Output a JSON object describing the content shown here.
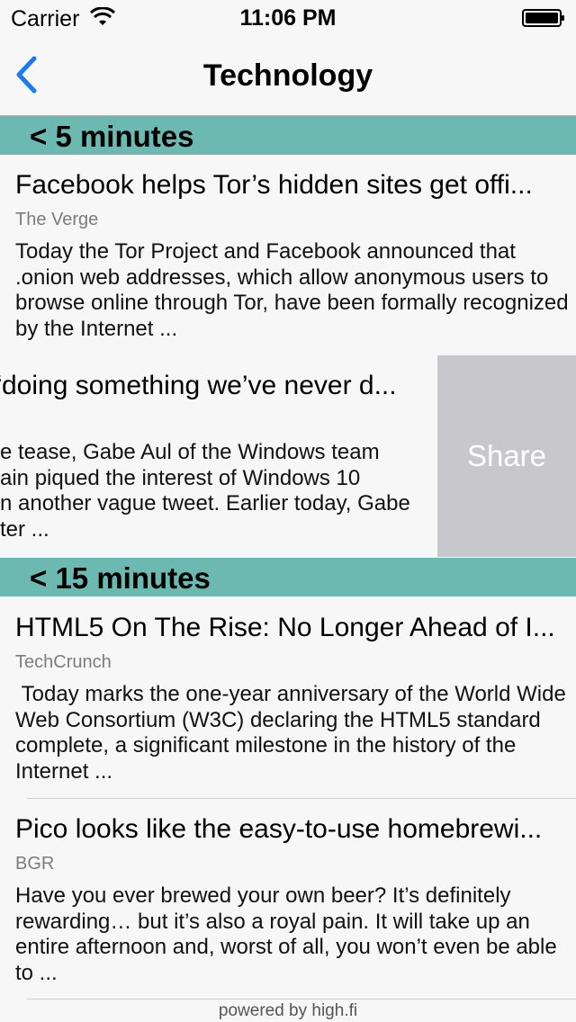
{
  "status_bar": {
    "carrier": "Carrier",
    "time": "11:06 PM"
  },
  "nav": {
    "title": "Technology"
  },
  "sections": [
    {
      "header": "< 5 minutes",
      "articles": [
        {
          "title": "Facebook helps Tor’s hidden sites get offi...",
          "source": "The Verge",
          "excerpt": "Today the Tor Project and Facebook announced that .onion web addresses, which allow anonymous users to browse online through Tor, have been formally recognized by the Internet ..."
        },
        {
          "title": "“doing something we’ve never d...",
          "excerpt_lines": [
            "e tease, Gabe Aul of the Windows team",
            "ain piqued the interest of Windows 10",
            "n another vague tweet. Earlier today, Gabe",
            "ter ..."
          ],
          "share_label": "Share"
        }
      ]
    },
    {
      "header": "< 15 minutes",
      "articles": [
        {
          "title": "HTML5 On The Rise: No Longer Ahead of I...",
          "source": "TechCrunch",
          "excerpt": " Today marks the one-year anniversary of the World Wide Web Consortium (W3C) declaring the HTML5 standard complete, a significant milestone in the history of the Internet ..."
        },
        {
          "title": "Pico looks like the easy-to-use homebrewi...",
          "source": "BGR",
          "excerpt": "Have you ever brewed your own beer? It’s definitely rewarding… but it’s also a royal pain. It will take up an entire afternoon and, worst of all, you won’t even be able to ..."
        }
      ]
    }
  ],
  "footer": "powered by high.fi",
  "colors": {
    "section_header": "#6bb9b0",
    "share_action": "#c8c7cc",
    "back_accent": "#1a7cf0"
  },
  "icons": [
    "wifi-icon",
    "battery-icon",
    "back-chevron-icon"
  ]
}
